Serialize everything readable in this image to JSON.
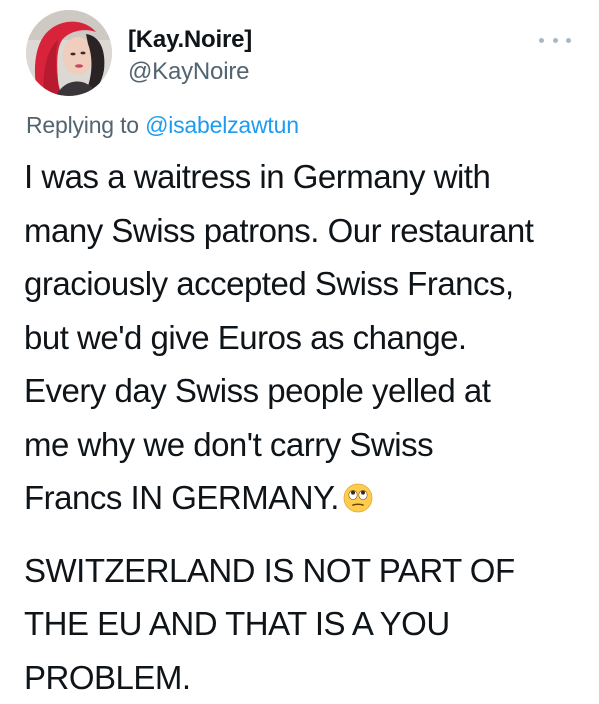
{
  "author": {
    "display_name": "[Kay.Noire]",
    "handle": "@KayNoire",
    "avatar_icon": "profile-photo"
  },
  "reply": {
    "prefix": "Replying to",
    "mention": "@isabelzawtun"
  },
  "more_icon": "more-options-icon",
  "tweet": {
    "paragraph1_lines": [
      "I was a waitress in Germany with",
      "many Swiss patrons. Our restaurant",
      "graciously accepted Swiss Francs,",
      "but we'd give Euros as change.",
      "Every day Swiss people yelled at",
      "me why we don't carry Swiss",
      "Francs IN GERMANY."
    ],
    "emoji": "face-with-rolling-eyes",
    "paragraph2_lines": [
      "SWITZERLAND IS NOT PART OF",
      "THE EU AND THAT IS A YOU",
      "PROBLEM."
    ]
  },
  "colors": {
    "text": "#0f1419",
    "secondary": "#536471",
    "link": "#1d9bf0"
  }
}
